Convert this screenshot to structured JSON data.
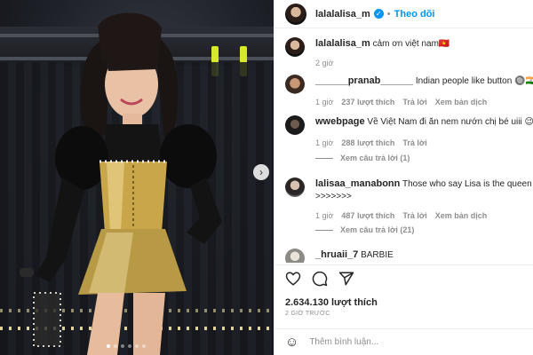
{
  "post": {
    "username": "lalalalisa_m",
    "follow_label": "Theo dõi",
    "separator": "•",
    "more_label": "•••"
  },
  "caption": {
    "username": "lalalalisa_m",
    "text": "cảm ơn việt nam🇻🇳",
    "time": "2 giờ"
  },
  "comments": [
    {
      "username": "______pranab______",
      "text": "Indian people like button 🔘🇮🇳",
      "time": "1 giờ",
      "likes": "237 lượt thích",
      "reply": "Trả lời",
      "translate": "Xem bản dịch"
    },
    {
      "username": "wwebpage",
      "text": "Về Việt Nam đi ăn nem nướn chị bé uiii 😉",
      "time": "1 giờ",
      "likes": "288 lượt thích",
      "reply": "Trả lời",
      "translate": "",
      "replies": "Xem câu trả lời (1)"
    },
    {
      "username": "lalisaa_manabonn",
      "text": "Those who say Lisa is the queen of kpop",
      "text2": ">>>>>>>",
      "time": "1 giờ",
      "likes": "487 lượt thích",
      "reply": "Trả lời",
      "translate": "Xem bản dịch",
      "replies": "Xem câu trả lời (21)"
    },
    {
      "username": "_hruaii_7",
      "text": "BARBIE"
    }
  ],
  "stats": {
    "likes": "2.634.130 lượt thích",
    "time": "2 GIỜ TRƯỚC"
  },
  "composer": {
    "placeholder": "Thêm bình luận..."
  },
  "icons": {
    "verified": "verified-badge",
    "like": "heart-icon",
    "comment": "comment-icon",
    "share": "share-icon",
    "save": "bookmark-icon",
    "emoji": "emoji-icon",
    "next": "chevron-right-icon"
  },
  "carousel": {
    "slides": 6,
    "active": 1
  }
}
